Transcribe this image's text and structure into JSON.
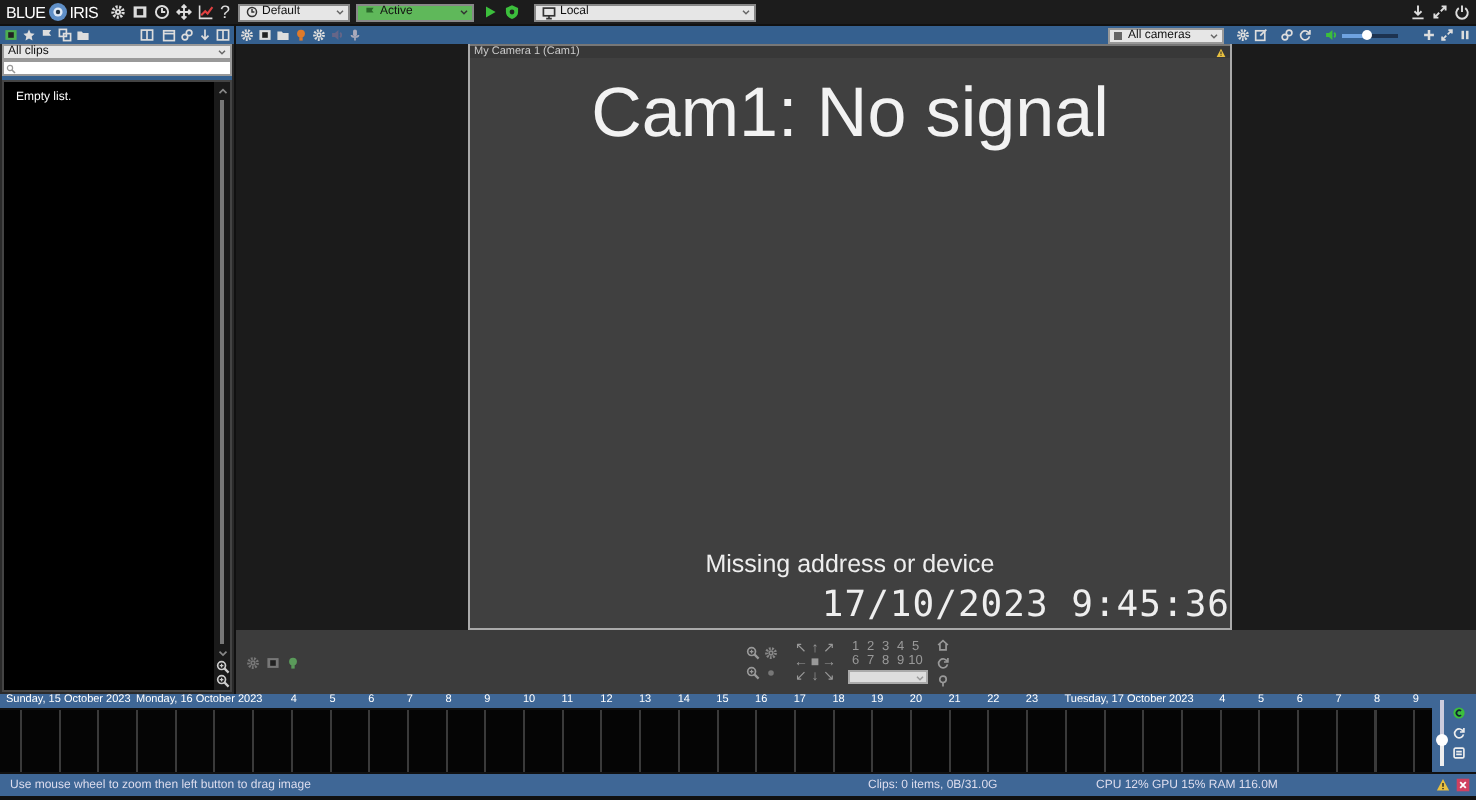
{
  "top_bar": {
    "logo": {
      "left": "BLUE",
      "right": "IRIS"
    },
    "help": "?",
    "profile": "Default",
    "schedule": "Active",
    "server": "Local"
  },
  "clips_panel": {
    "filter": "All clips",
    "empty_message": "Empty list."
  },
  "camera_toolbar": {
    "group": "All cameras",
    "volume": {
      "level": 0.45
    }
  },
  "camera": {
    "title": "My Camera 1 (Cam1)",
    "message": "Cam1: No signal",
    "detail": "Missing address or device",
    "timestamp": "17/10/2023 9:45:36"
  },
  "ptz": {
    "arrows": [
      "↖",
      "↑",
      "↗",
      "←",
      "■",
      "→",
      "↙",
      "↓",
      "↘"
    ],
    "presets": [
      "1",
      "2",
      "3",
      "4",
      "5",
      "6",
      "7",
      "8",
      "9",
      "10"
    ]
  },
  "timeline": {
    "labels": [
      {
        "kind": "day",
        "text": "Sunday, 15 October 2023"
      },
      {
        "kind": "day",
        "text": "Monday, 16 October 2023"
      },
      {
        "kind": "hour",
        "text": "4"
      },
      {
        "kind": "hour",
        "text": "5"
      },
      {
        "kind": "hour",
        "text": "6"
      },
      {
        "kind": "hour",
        "text": "7"
      },
      {
        "kind": "hour",
        "text": "8"
      },
      {
        "kind": "hour",
        "text": "9"
      },
      {
        "kind": "hour",
        "text": "10"
      },
      {
        "kind": "hour",
        "text": "11"
      },
      {
        "kind": "hour",
        "text": "12"
      },
      {
        "kind": "hour",
        "text": "13"
      },
      {
        "kind": "hour",
        "text": "14"
      },
      {
        "kind": "hour",
        "text": "15"
      },
      {
        "kind": "hour",
        "text": "16"
      },
      {
        "kind": "hour",
        "text": "17"
      },
      {
        "kind": "hour",
        "text": "18"
      },
      {
        "kind": "hour",
        "text": "19"
      },
      {
        "kind": "hour",
        "text": "20"
      },
      {
        "kind": "hour",
        "text": "21"
      },
      {
        "kind": "hour",
        "text": "22"
      },
      {
        "kind": "hour",
        "text": "23"
      },
      {
        "kind": "day",
        "text": "Tuesday, 17 October 2023"
      },
      {
        "kind": "hour",
        "text": "4"
      },
      {
        "kind": "hour",
        "text": "5"
      },
      {
        "kind": "hour",
        "text": "6"
      },
      {
        "kind": "hour",
        "text": "7"
      },
      {
        "kind": "hour",
        "text": "8"
      },
      {
        "kind": "hour",
        "text": "9"
      }
    ],
    "zoom": {
      "level": 0.4
    }
  },
  "status_bar": {
    "hint": "Use mouse wheel to zoom then left button to drag image",
    "clips": "Clips: 0 items, 0B/31.0G",
    "performance": "CPU 12% GPU 15% RAM 116.0M"
  }
}
